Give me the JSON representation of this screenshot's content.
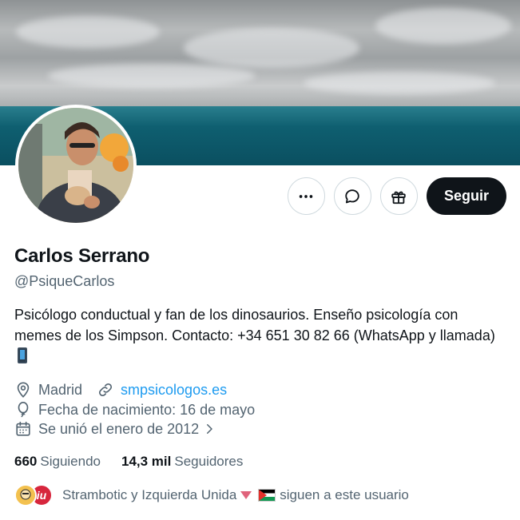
{
  "profile": {
    "name": "Carlos Serrano",
    "handle": "@PsiqueCarlos",
    "bio": "Psicólogo conductual y fan de los dinosaurios. Enseño psicología con memes de los Simpson. Contacto: +34 651 30 82 66 (WhatsApp y llamada)",
    "bio_emoji": "mobile-phone-icon",
    "location": "Madrid",
    "website": "smpsicologos.es",
    "birthday": "Fecha de nacimiento: 16 de mayo",
    "joined": "Se unió el enero de 2012"
  },
  "actions": {
    "more_icon": "more-icon",
    "message_icon": "message-icon",
    "gift_icon": "gift-icon",
    "follow_label": "Seguir"
  },
  "stats": {
    "following_count": "660",
    "following_label": "Siguiendo",
    "followers_count": "14,3 mil",
    "followers_label": "Seguidores"
  },
  "followed_by": {
    "names": "Strambotic y Izquierda Unida",
    "suffix": "sigue a este usuario",
    "suffix_full": "siguen a este usuario"
  },
  "colors": {
    "accent": "#1d9bf0",
    "follow_bg": "#0f1419",
    "secondary_text": "#536471"
  }
}
